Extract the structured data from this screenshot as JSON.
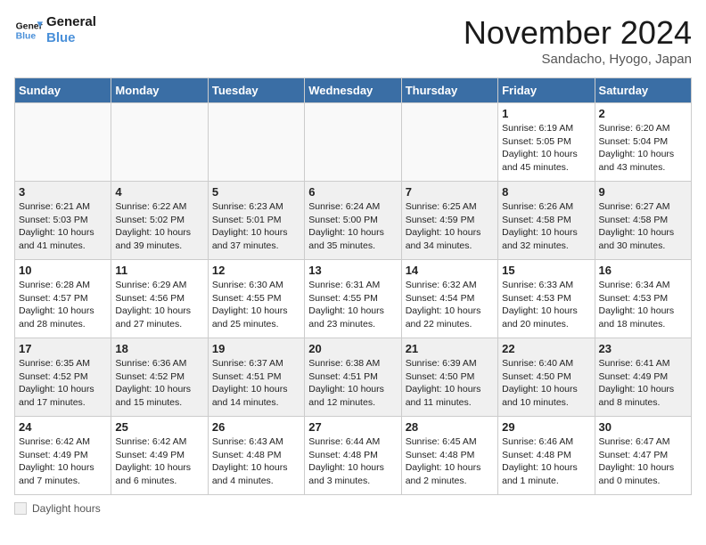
{
  "logo": {
    "line1": "General",
    "line2": "Blue"
  },
  "title": "November 2024",
  "location": "Sandacho, Hyogo, Japan",
  "days_of_week": [
    "Sunday",
    "Monday",
    "Tuesday",
    "Wednesday",
    "Thursday",
    "Friday",
    "Saturday"
  ],
  "footer": {
    "label": "Daylight hours"
  },
  "weeks": [
    [
      {
        "day": "",
        "info": ""
      },
      {
        "day": "",
        "info": ""
      },
      {
        "day": "",
        "info": ""
      },
      {
        "day": "",
        "info": ""
      },
      {
        "day": "",
        "info": ""
      },
      {
        "day": "1",
        "info": "Sunrise: 6:19 AM\nSunset: 5:05 PM\nDaylight: 10 hours and 45 minutes."
      },
      {
        "day": "2",
        "info": "Sunrise: 6:20 AM\nSunset: 5:04 PM\nDaylight: 10 hours and 43 minutes."
      }
    ],
    [
      {
        "day": "3",
        "info": "Sunrise: 6:21 AM\nSunset: 5:03 PM\nDaylight: 10 hours and 41 minutes."
      },
      {
        "day": "4",
        "info": "Sunrise: 6:22 AM\nSunset: 5:02 PM\nDaylight: 10 hours and 39 minutes."
      },
      {
        "day": "5",
        "info": "Sunrise: 6:23 AM\nSunset: 5:01 PM\nDaylight: 10 hours and 37 minutes."
      },
      {
        "day": "6",
        "info": "Sunrise: 6:24 AM\nSunset: 5:00 PM\nDaylight: 10 hours and 35 minutes."
      },
      {
        "day": "7",
        "info": "Sunrise: 6:25 AM\nSunset: 4:59 PM\nDaylight: 10 hours and 34 minutes."
      },
      {
        "day": "8",
        "info": "Sunrise: 6:26 AM\nSunset: 4:58 PM\nDaylight: 10 hours and 32 minutes."
      },
      {
        "day": "9",
        "info": "Sunrise: 6:27 AM\nSunset: 4:58 PM\nDaylight: 10 hours and 30 minutes."
      }
    ],
    [
      {
        "day": "10",
        "info": "Sunrise: 6:28 AM\nSunset: 4:57 PM\nDaylight: 10 hours and 28 minutes."
      },
      {
        "day": "11",
        "info": "Sunrise: 6:29 AM\nSunset: 4:56 PM\nDaylight: 10 hours and 27 minutes."
      },
      {
        "day": "12",
        "info": "Sunrise: 6:30 AM\nSunset: 4:55 PM\nDaylight: 10 hours and 25 minutes."
      },
      {
        "day": "13",
        "info": "Sunrise: 6:31 AM\nSunset: 4:55 PM\nDaylight: 10 hours and 23 minutes."
      },
      {
        "day": "14",
        "info": "Sunrise: 6:32 AM\nSunset: 4:54 PM\nDaylight: 10 hours and 22 minutes."
      },
      {
        "day": "15",
        "info": "Sunrise: 6:33 AM\nSunset: 4:53 PM\nDaylight: 10 hours and 20 minutes."
      },
      {
        "day": "16",
        "info": "Sunrise: 6:34 AM\nSunset: 4:53 PM\nDaylight: 10 hours and 18 minutes."
      }
    ],
    [
      {
        "day": "17",
        "info": "Sunrise: 6:35 AM\nSunset: 4:52 PM\nDaylight: 10 hours and 17 minutes."
      },
      {
        "day": "18",
        "info": "Sunrise: 6:36 AM\nSunset: 4:52 PM\nDaylight: 10 hours and 15 minutes."
      },
      {
        "day": "19",
        "info": "Sunrise: 6:37 AM\nSunset: 4:51 PM\nDaylight: 10 hours and 14 minutes."
      },
      {
        "day": "20",
        "info": "Sunrise: 6:38 AM\nSunset: 4:51 PM\nDaylight: 10 hours and 12 minutes."
      },
      {
        "day": "21",
        "info": "Sunrise: 6:39 AM\nSunset: 4:50 PM\nDaylight: 10 hours and 11 minutes."
      },
      {
        "day": "22",
        "info": "Sunrise: 6:40 AM\nSunset: 4:50 PM\nDaylight: 10 hours and 10 minutes."
      },
      {
        "day": "23",
        "info": "Sunrise: 6:41 AM\nSunset: 4:49 PM\nDaylight: 10 hours and 8 minutes."
      }
    ],
    [
      {
        "day": "24",
        "info": "Sunrise: 6:42 AM\nSunset: 4:49 PM\nDaylight: 10 hours and 7 minutes."
      },
      {
        "day": "25",
        "info": "Sunrise: 6:42 AM\nSunset: 4:49 PM\nDaylight: 10 hours and 6 minutes."
      },
      {
        "day": "26",
        "info": "Sunrise: 6:43 AM\nSunset: 4:48 PM\nDaylight: 10 hours and 4 minutes."
      },
      {
        "day": "27",
        "info": "Sunrise: 6:44 AM\nSunset: 4:48 PM\nDaylight: 10 hours and 3 minutes."
      },
      {
        "day": "28",
        "info": "Sunrise: 6:45 AM\nSunset: 4:48 PM\nDaylight: 10 hours and 2 minutes."
      },
      {
        "day": "29",
        "info": "Sunrise: 6:46 AM\nSunset: 4:48 PM\nDaylight: 10 hours and 1 minute."
      },
      {
        "day": "30",
        "info": "Sunrise: 6:47 AM\nSunset: 4:47 PM\nDaylight: 10 hours and 0 minutes."
      }
    ]
  ]
}
